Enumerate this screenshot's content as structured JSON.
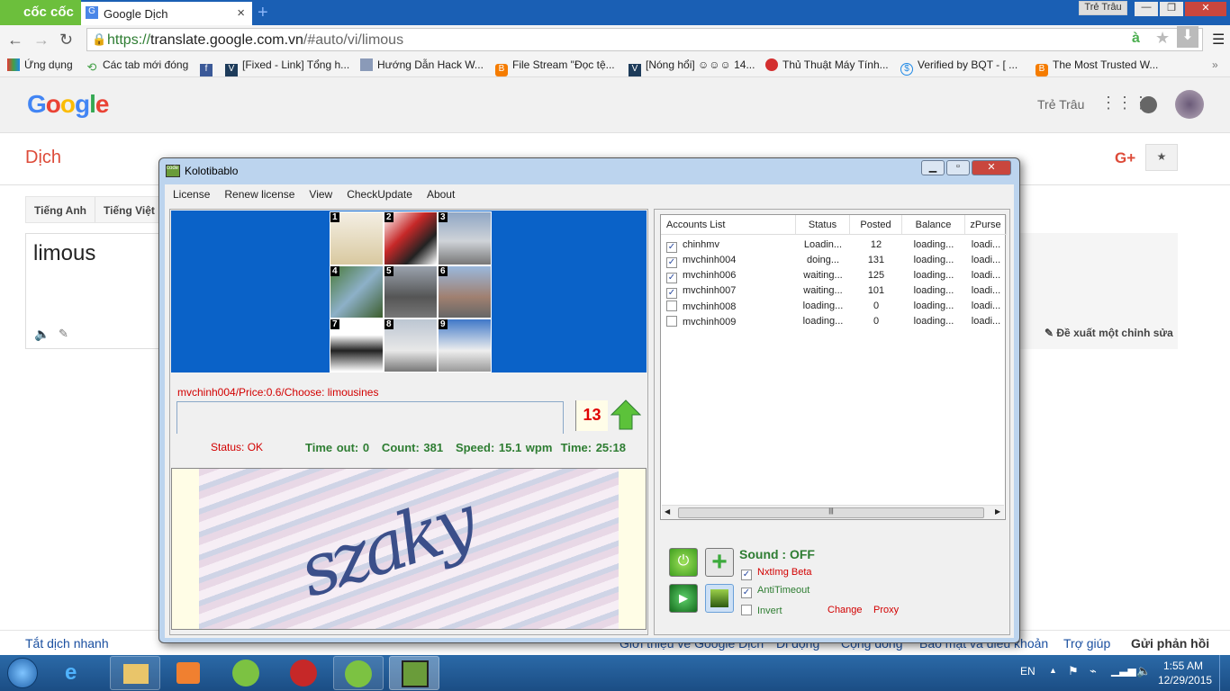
{
  "browser": {
    "brand": "cốc cốc",
    "tab_title": "Google Dịch",
    "user_button": "Trẻ Trâu",
    "url_scheme": "https://",
    "url_domain": "translate.google.com.vn",
    "url_path": "/#auto/vi/limous",
    "bookmarks": [
      "Ứng dụng",
      "Các tab mới đóng",
      "",
      "[Fixed - Link] Tổng h...",
      "Hướng Dẫn Hack W...",
      "File Stream \"Đọc tệ...",
      "[Nóng hổi] ☺☺☺ 14...",
      "Thủ Thuật Máy Tính...",
      "Verified by BQT - [ ...",
      "The Most Trusted W..."
    ],
    "more": "»"
  },
  "google": {
    "logo": "Google",
    "user": "Trẻ Trâu",
    "section": "Dịch",
    "lang_tabs": [
      "Tiếng Anh",
      "Tiếng Việt"
    ],
    "source_text": "limous",
    "suggest_edit": "Đề xuất một chỉnh sửa",
    "gplus": "G+",
    "footer": [
      "Tắt dịch nhanh",
      "Giới thiệu về Google Dịch",
      "Di động",
      "Cộng đồng",
      "Bảo mật và điều khoản",
      "Trợ giúp",
      "Gửi phản hồi"
    ]
  },
  "app": {
    "title": "Kolotibablo",
    "menu": [
      "License",
      "Renew license",
      "View",
      "CheckUpdate",
      "About"
    ],
    "grid_numbers": [
      "1",
      "2",
      "3",
      "4",
      "5",
      "6",
      "7",
      "8",
      "9"
    ],
    "task": "mvchinh004/Price:0.6/Choose: limousines",
    "countdown": "13",
    "status": "Status: OK",
    "stats": "Time out: 0   Count: 381   Speed: 15.1 wpm  Time: 25:18",
    "captcha_text": "szaky",
    "columns": [
      "Accounts List",
      "Status",
      "Posted",
      "Balance",
      "zPurse"
    ],
    "accounts": [
      {
        "checked": true,
        "name": "chinhmv",
        "status": "Loadin...",
        "posted": "12",
        "balance": "loading...",
        "zpurse": "loadi..."
      },
      {
        "checked": true,
        "name": "mvchinh004",
        "status": "doing...",
        "posted": "131",
        "balance": "loading...",
        "zpurse": "loadi..."
      },
      {
        "checked": true,
        "name": "mvchinh006",
        "status": "waiting...",
        "posted": "125",
        "balance": "loading...",
        "zpurse": "loadi..."
      },
      {
        "checked": true,
        "name": "mvchinh007",
        "status": "waiting...",
        "posted": "101",
        "balance": "loading...",
        "zpurse": "loadi..."
      },
      {
        "checked": false,
        "name": "mvchinh008",
        "status": "loading...",
        "posted": "0",
        "balance": "loading...",
        "zpurse": "loadi..."
      },
      {
        "checked": false,
        "name": "mvchinh009",
        "status": "loading...",
        "posted": "0",
        "balance": "loading...",
        "zpurse": "loadi..."
      }
    ],
    "sound": "Sound : OFF",
    "options": [
      {
        "label": "NxtImg Beta",
        "checked": true
      },
      {
        "label": "AntiTimeout",
        "checked": true
      },
      {
        "label": "Invert",
        "checked": false
      }
    ],
    "change": "Change",
    "proxy": "Proxy"
  },
  "taskbar": {
    "lang": "EN",
    "time": "1:55 AM",
    "date": "12/29/2015"
  }
}
